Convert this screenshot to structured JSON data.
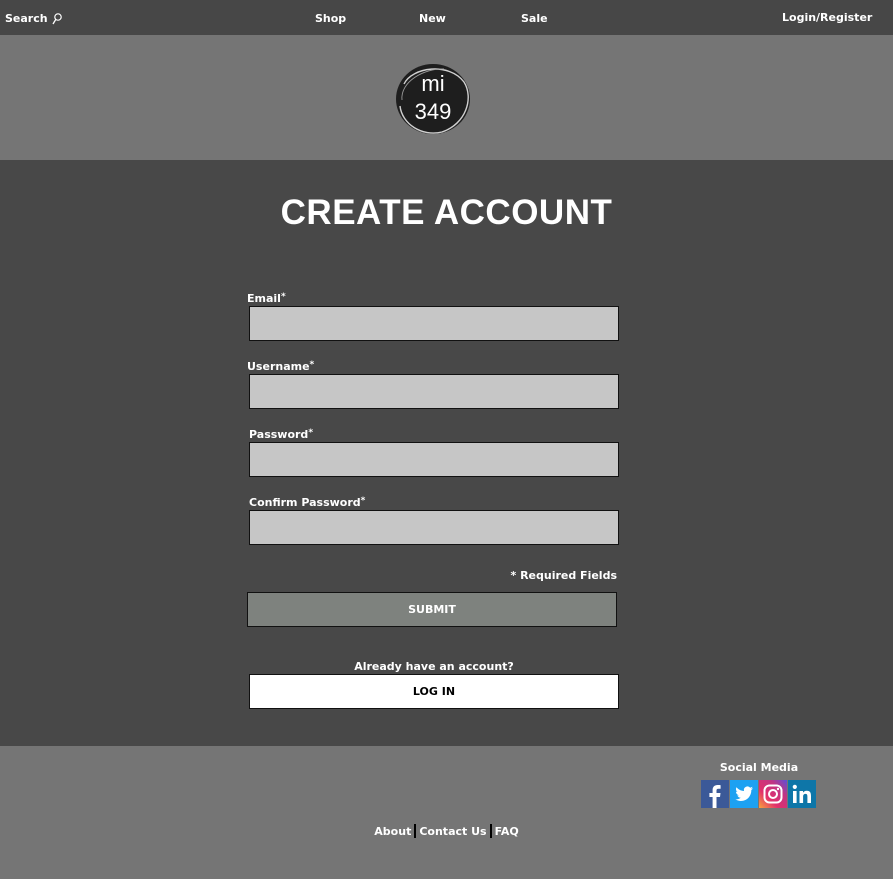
{
  "nav": {
    "search_label": "Search",
    "links": [
      "Shop",
      "New",
      "Sale"
    ],
    "login_label": "Login/Register"
  },
  "logo": {
    "line1": "mi",
    "line2": "349"
  },
  "form": {
    "title": "CREATE ACCOUNT",
    "fields": [
      {
        "label": "Email",
        "value": "",
        "placeholder": ""
      },
      {
        "label": "Username",
        "value": "",
        "placeholder": ""
      },
      {
        "label": "Password",
        "value": "",
        "placeholder": ""
      },
      {
        "label": "Confirm Password",
        "value": "",
        "placeholder": ""
      }
    ],
    "asterisk": "*",
    "required_note": "* Required Fields",
    "submit_label": "SUBMIT",
    "already_text": "Already have an account?",
    "login_button": "LOG IN"
  },
  "footer": {
    "social_title": "Social Media",
    "social_icons": [
      "facebook-icon",
      "twitter-icon",
      "instagram-icon",
      "linkedin-icon"
    ],
    "links": [
      "About",
      "Contact Us",
      "FAQ"
    ]
  },
  "colors": {
    "nav_bg": "#474747",
    "header_bg": "#757575",
    "main_bg": "#484848",
    "input_bg": "#c6c6c6",
    "submit_bg": "#7e827e",
    "facebook": "#3b5998",
    "twitter": "#1da1f2",
    "linkedin": "#0e76a8"
  }
}
